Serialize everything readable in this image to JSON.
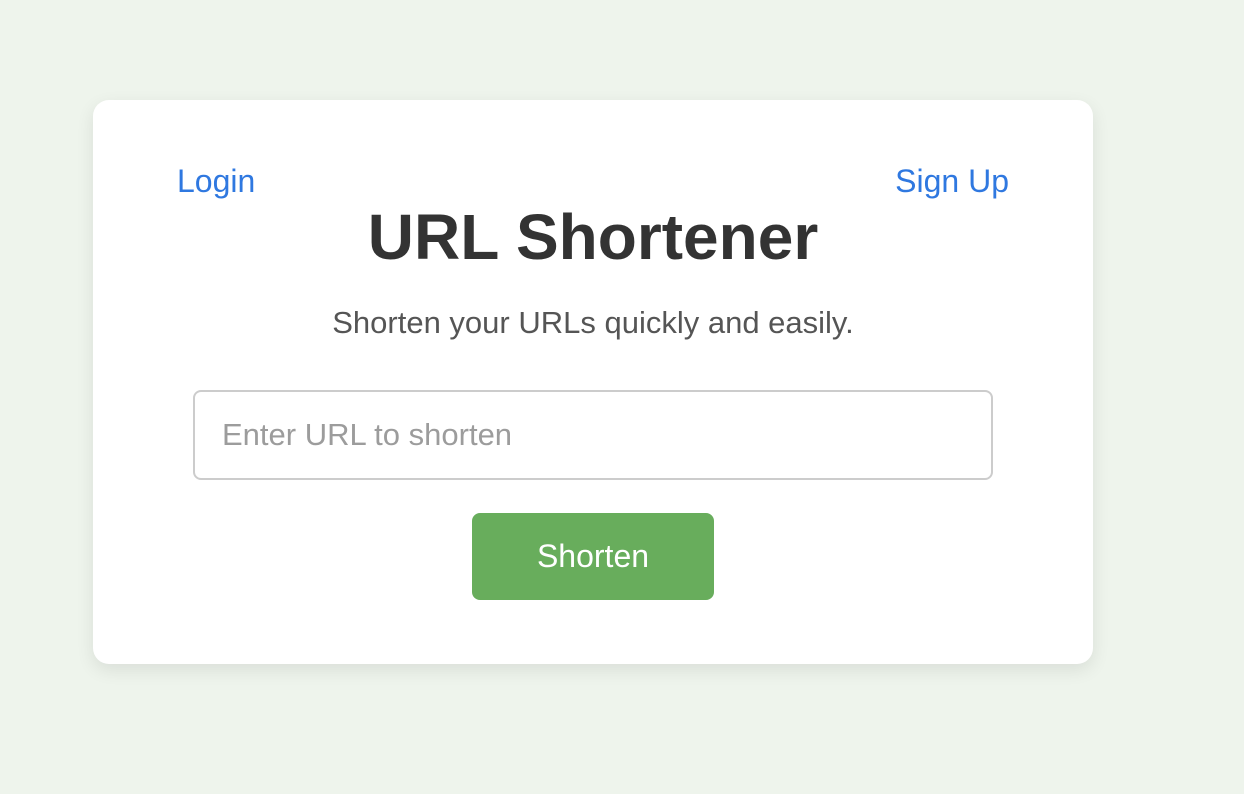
{
  "nav": {
    "login_label": "Login",
    "signup_label": "Sign Up"
  },
  "header": {
    "title": "URL Shortener",
    "subtitle": "Shorten your URLs quickly and easily."
  },
  "form": {
    "url_input": {
      "value": "",
      "placeholder": "Enter URL to shorten"
    },
    "submit_label": "Shorten"
  },
  "colors": {
    "page_background": "#eef4ec",
    "card_background": "#ffffff",
    "link": "#2f78e0",
    "button": "#68ad5c",
    "title_text": "#333333",
    "subtitle_text": "#555555"
  }
}
